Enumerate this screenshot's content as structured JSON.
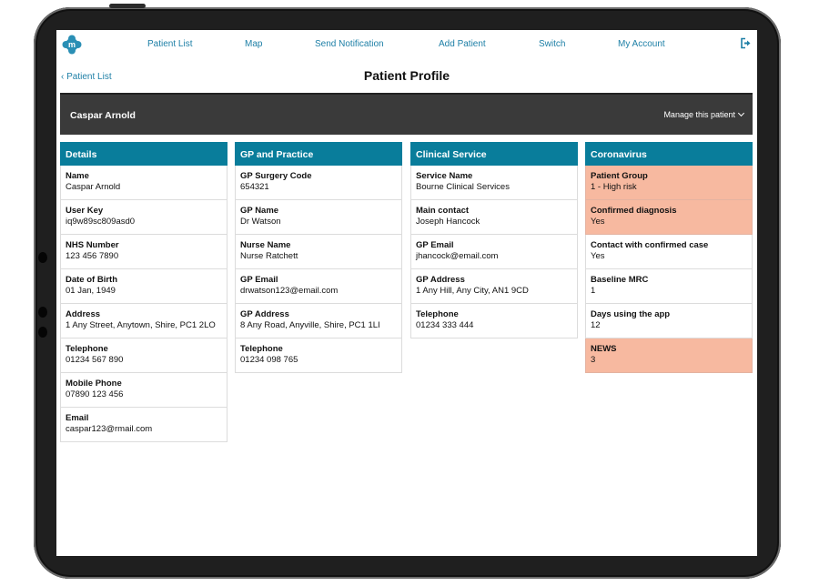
{
  "nav": {
    "items": [
      {
        "label": "Patient List"
      },
      {
        "label": "Map"
      },
      {
        "label": "Send Notification"
      },
      {
        "label": "Add Patient"
      },
      {
        "label": "Switch"
      },
      {
        "label": "My Account"
      }
    ]
  },
  "back_link": "Patient List",
  "page_title": "Patient Profile",
  "banner": {
    "patient_name": "Caspar Arnold",
    "manage_label": "Manage this patient"
  },
  "colors": {
    "accent": "#097d9b",
    "link": "#1d7fa6",
    "highlight": "#f7b9a0",
    "banner": "#3a3a3a"
  },
  "icons": {
    "logo": "brand-logo-icon",
    "back": "chevron-left-icon",
    "manage": "chevron-down-icon",
    "logout": "logout-icon"
  },
  "columns": [
    {
      "title": "Details",
      "fields": [
        {
          "label": "Name",
          "value": "Caspar Arnold",
          "highlight": false
        },
        {
          "label": "User Key",
          "value": "iq9w89sc809asd0",
          "highlight": false
        },
        {
          "label": "NHS Number",
          "value": "123 456 7890",
          "highlight": false
        },
        {
          "label": "Date of Birth",
          "value": "01 Jan, 1949",
          "highlight": false
        },
        {
          "label": "Address",
          "value": "1 Any Street, Anytown, Shire, PC1 2LO",
          "highlight": false
        },
        {
          "label": "Telephone",
          "value": "01234 567 890",
          "highlight": false
        },
        {
          "label": "Mobile Phone",
          "value": "07890 123 456",
          "highlight": false
        },
        {
          "label": "Email",
          "value": "caspar123@rmail.com",
          "highlight": false
        }
      ]
    },
    {
      "title": "GP and Practice",
      "fields": [
        {
          "label": "GP Surgery Code",
          "value": "654321",
          "highlight": false
        },
        {
          "label": "GP Name",
          "value": "Dr Watson",
          "highlight": false
        },
        {
          "label": "Nurse Name",
          "value": "Nurse Ratchett",
          "highlight": false
        },
        {
          "label": "GP Email",
          "value": "drwatson123@email.com",
          "highlight": false
        },
        {
          "label": "GP Address",
          "value": "8 Any Road, Anyville, Shire, PC1 1LI",
          "highlight": false
        },
        {
          "label": "Telephone",
          "value": "01234 098 765",
          "highlight": false
        }
      ]
    },
    {
      "title": "Clinical Service",
      "fields": [
        {
          "label": "Service Name",
          "value": "Bourne Clinical Services",
          "highlight": false
        },
        {
          "label": "Main contact",
          "value": "Joseph Hancock",
          "highlight": false
        },
        {
          "label": "GP Email",
          "value": "jhancock@email.com",
          "highlight": false
        },
        {
          "label": "GP Address",
          "value": "1 Any Hill, Any City, AN1 9CD",
          "highlight": false
        },
        {
          "label": "Telephone",
          "value": "01234 333 444",
          "highlight": false
        }
      ]
    },
    {
      "title": "Coronavirus",
      "fields": [
        {
          "label": "Patient Group",
          "value": "1 - High risk",
          "highlight": true
        },
        {
          "label": "Confirmed diagnosis",
          "value": "Yes",
          "highlight": true
        },
        {
          "label": "Contact with confirmed case",
          "value": "Yes",
          "highlight": false
        },
        {
          "label": "Baseline MRC",
          "value": "1",
          "highlight": false
        },
        {
          "label": "Days using the app",
          "value": "12",
          "highlight": false
        },
        {
          "label": "NEWS",
          "value": "3",
          "highlight": true
        }
      ]
    }
  ]
}
